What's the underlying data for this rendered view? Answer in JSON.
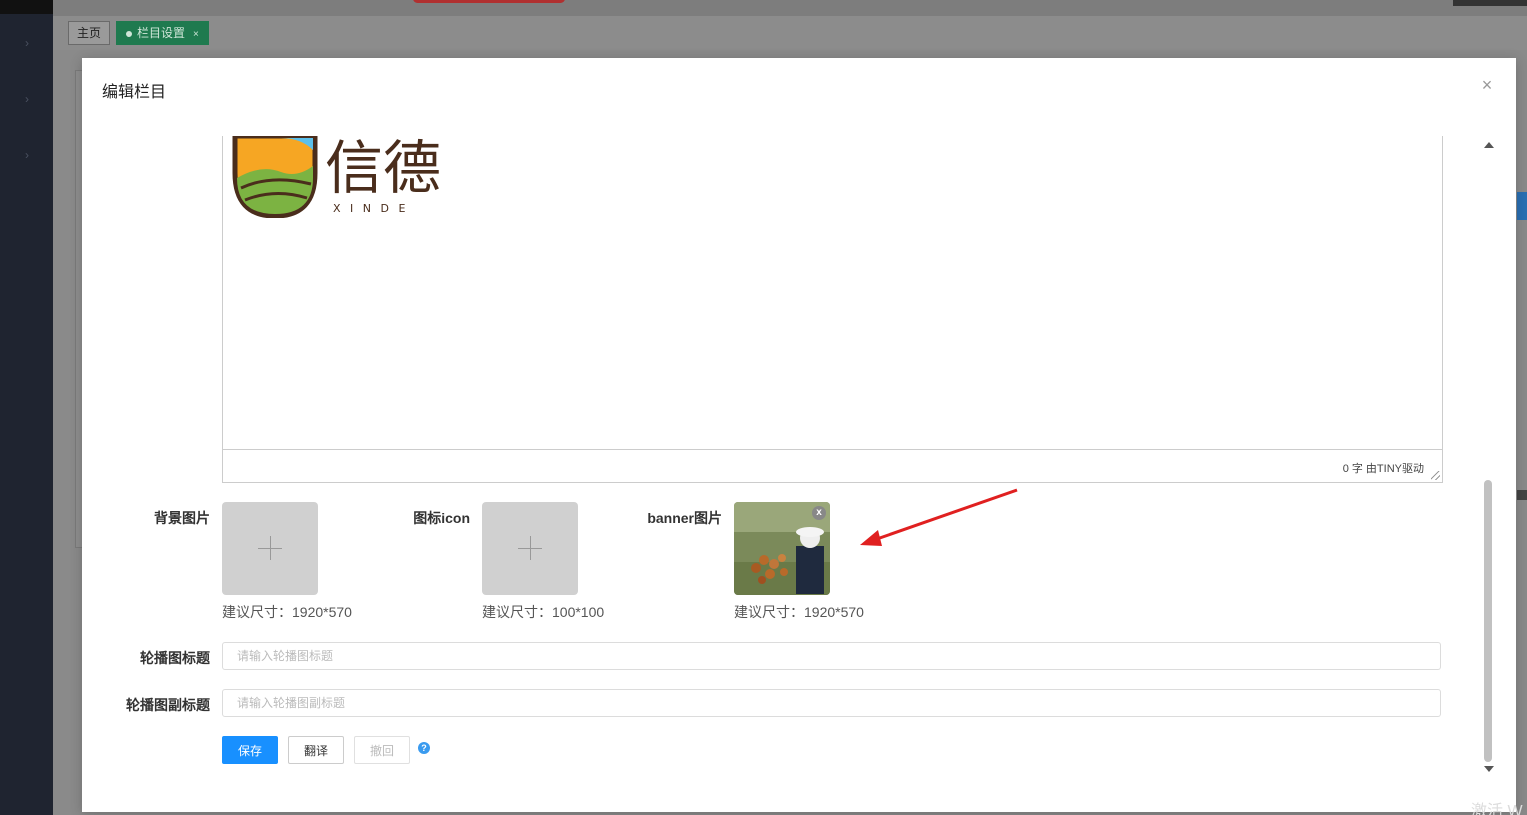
{
  "tabs": {
    "home": "主页",
    "active": "栏目设置",
    "active_close": "×"
  },
  "modal": {
    "title": "编辑栏目",
    "close_icon": "close-icon"
  },
  "editor": {
    "logo_text": "信德",
    "logo_subtext": "X I N D E",
    "status": "0 字 由TINY驱动"
  },
  "uploads": [
    {
      "label": "背景图片",
      "hint": "建议尺寸：1920*570",
      "has_image": false
    },
    {
      "label": "图标icon",
      "hint": "建议尺寸：100*100",
      "has_image": false
    },
    {
      "label": "banner图片",
      "hint": "建议尺寸：1920*570",
      "has_image": true
    }
  ],
  "thumb_close": "x",
  "carousel_title": {
    "label": "轮播图标题",
    "placeholder": "请输入轮播图标题",
    "value": ""
  },
  "carousel_subtitle": {
    "label": "轮播图副标题",
    "placeholder": "请输入轮播图副标题",
    "value": ""
  },
  "buttons": {
    "save": "保存",
    "translate": "翻译",
    "revoke": "撤回",
    "help": "?"
  },
  "watermark": "激活 W",
  "colors": {
    "primary": "#1890ff",
    "active_tab": "#1f7a4f",
    "arrow": "#e02020"
  }
}
